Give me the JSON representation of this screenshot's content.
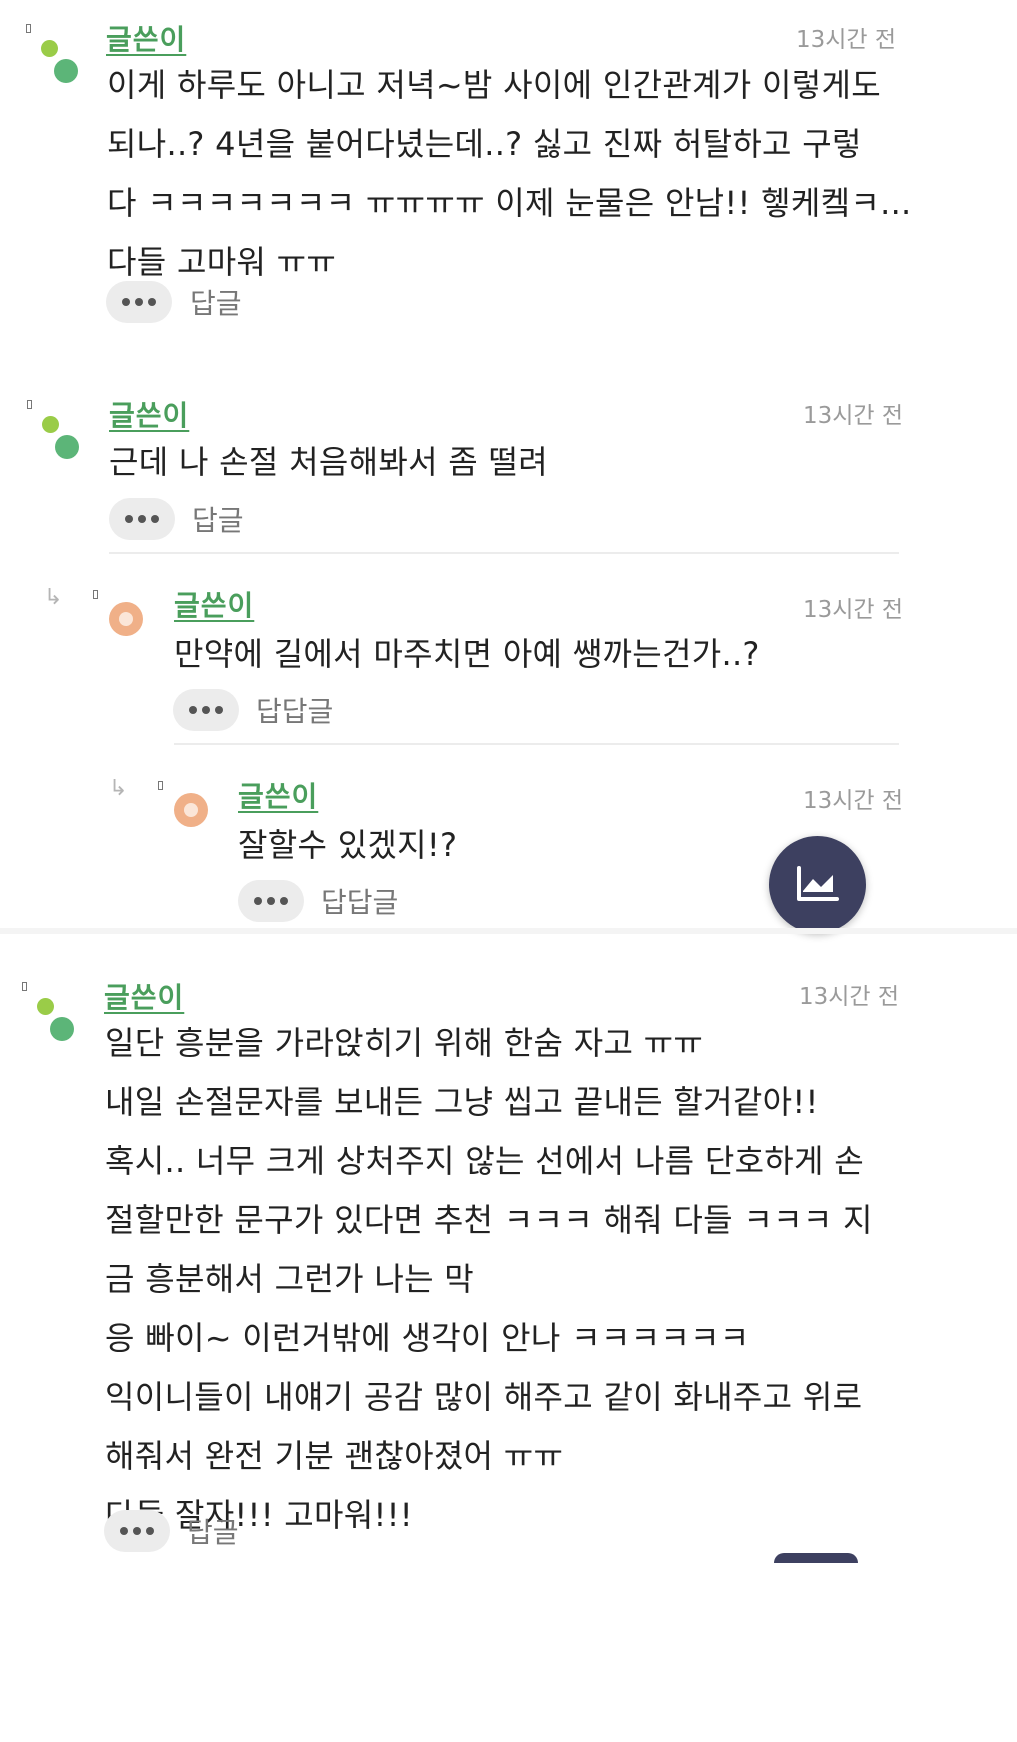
{
  "comments": [
    {
      "author": "글쓴이",
      "time": "13시간 전",
      "lines": [
        "이게 하루도 아니고 저녁~밤 사이에 인간관계가 이렇게도",
        "되나..? 4년을 붙어다녔는데..? 싫고 진짜 허탈하고 구렇",
        "다 ㅋㅋㅋㅋㅋㅋㅋ ㅠㅠㅠㅠ 이제 눈물은 안남!! 헿케켘ㅋ...",
        "다들 고마워 ㅠㅠ"
      ],
      "reply_label": "답글"
    },
    {
      "author": "글쓴이",
      "time": "13시간 전",
      "lines": [
        "근데 나 손절 처음해봐서 좀 떨려"
      ],
      "reply_label": "답글"
    },
    {
      "author": "글쓴이",
      "time": "13시간 전",
      "lines": [
        "만약에 길에서 마주치면 아예 쌩까는건가..?"
      ],
      "reply_label": "답답글"
    },
    {
      "author": "글쓴이",
      "time": "13시간 전",
      "lines": [
        "잘할수 있겠지!?"
      ],
      "reply_label": "답답글"
    },
    {
      "author": "글쓴이",
      "time": "13시간 전",
      "lines": [
        "일단 흥분을 가라앉히기 위해 한숨 자고 ㅠㅠ",
        "내일 손절문자를 보내든 그냥 씹고 끝내든 할거같아!!",
        "혹시.. 너무 크게 상처주지 않는 선에서 나름 단호하게 손",
        "절할만한 문구가 있다면 추천 ㅋㅋㅋ 해줘 다들 ㅋㅋㅋ 지",
        "금 흥분해서 그런가 나는 막",
        "응 빠이~ 이런거밖에 생각이 안나 ㅋㅋㅋㅋㅋㅋ",
        "익이니들이 내얘기 공감 많이 해주고 같이 화내주고 위로",
        "해줘서 완전 기분 괜찮아졌어 ㅠㅠ",
        "다들 잘자!!! 고마워!!!"
      ],
      "reply_label": "답글"
    }
  ],
  "fab": {
    "icon": "trend-chart-icon",
    "color": "#3d4060"
  },
  "colors": {
    "author": "#4a9e5c",
    "time": "#9a9a9a",
    "avatar_light": "#9acc48",
    "avatar_dark": "#5cb578",
    "reply_avatar": "#f0b088"
  }
}
